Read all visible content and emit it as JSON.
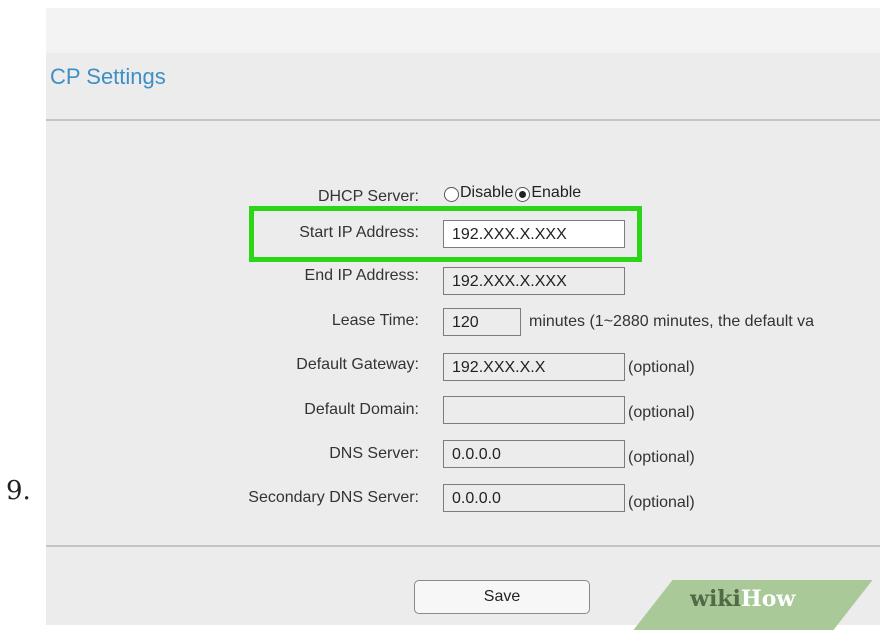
{
  "step_number": "9.",
  "page": {
    "title": "CP Settings"
  },
  "form": {
    "dhcp_server": {
      "label": "DHCP Server:",
      "option_disable": "Disable",
      "option_enable": "Enable",
      "selected": "Enable"
    },
    "start_ip": {
      "label": "Start IP Address:",
      "value": "192.XXX.X.XXX"
    },
    "end_ip": {
      "label": "End IP Address:",
      "value": "192.XXX.X.XXX"
    },
    "lease_time": {
      "label": "Lease Time:",
      "value": "120",
      "note": "minutes (1~2880 minutes, the default va"
    },
    "default_gateway": {
      "label": "Default Gateway:",
      "value": "192.XXX.X.X",
      "note": "(optional)"
    },
    "default_domain": {
      "label": "Default Domain:",
      "value": "",
      "note": "(optional)"
    },
    "dns_server": {
      "label": "DNS Server:",
      "value": "0.0.0.0",
      "note": "(optional)"
    },
    "secondary_dns": {
      "label": "Secondary DNS Server:",
      "value": "0.0.0.0",
      "note": "(optional)"
    }
  },
  "actions": {
    "save_label": "Save"
  },
  "watermark": {
    "wiki": "wiki",
    "how": "How"
  },
  "colors": {
    "title": "#3d8fc6",
    "highlight": "#2bd616",
    "panel_bg": "#ececec"
  }
}
